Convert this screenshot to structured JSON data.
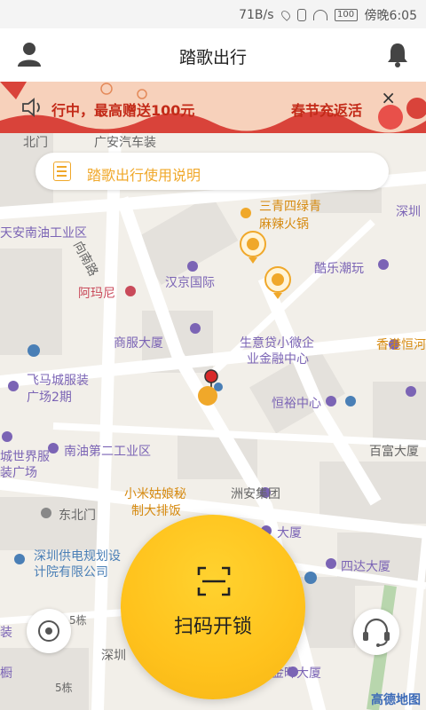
{
  "status_bar": {
    "speed": "71B/s",
    "battery": "100",
    "time": "傍晚6:05",
    "icons": [
      "location-icon",
      "vibrate-icon",
      "wifi-icon",
      "battery-icon"
    ]
  },
  "header": {
    "title": "踏歌出行",
    "left_icon": "user-icon",
    "right_icon": "bell-icon"
  },
  "banner": {
    "text_left": "行中，最高赠送100元",
    "text_right": "春节充返活",
    "close": "×",
    "icon": "speaker-icon"
  },
  "search": {
    "text": "踏歌出行使用说明",
    "icon": "document-icon"
  },
  "map": {
    "labels": {
      "beimen": "北门",
      "guangan": "广安汽车装",
      "sanqing1": "三青四绿青",
      "sanqing2": "麻辣火锅",
      "shenzhen": "深圳",
      "tiananindustrial": "天安南油工业区",
      "xiangnanlu": "向南路",
      "hanjing": "汉京国际",
      "kule": "酷乐潮玩",
      "armani": "阿玛尼",
      "shangfu": "商服大厦",
      "shengyidai1": "生意贷小微企",
      "shengyidai2": "业金融中心",
      "hengyu": "恒裕中心",
      "xianggang": "香港恒河",
      "feima1": "飞马城服装",
      "feima2": "广场2期",
      "nanyou2": "南油第二工业区",
      "chengshijie1": "城世界服",
      "chengshijie2": "装广场",
      "baifu": "百富大厦",
      "xiaomigu1": "小米姑娘秘",
      "xiaomigu2": "制大排饭",
      "zhouan": "洲安集团",
      "dongbeimen": "东北门",
      "gongdian1": "深圳供电规划设",
      "gongdian2": "计院有限公司",
      "dasha": "大厦",
      "sida": "四达大厦",
      "building5a": "5栋",
      "building5b": "5栋",
      "zhuang": "装",
      "chu": "橱",
      "shenzhenbottom": "深圳",
      "jinhui": "金晖大厦"
    }
  },
  "scan_button": {
    "label": "扫码开锁",
    "icon": "scan-icon"
  },
  "locate_button": {
    "icon": "locate-icon"
  },
  "support_button": {
    "icon": "headset-icon"
  },
  "watermark": "高德地图",
  "colors": {
    "accent_yellow": "#ffc21c",
    "text_orange": "#f0a82a",
    "banner_red": "#c32a18",
    "banner_bg": "#f7d1bb",
    "map_bg": "#f2efe9",
    "poi_purple": "#7b64b5"
  }
}
